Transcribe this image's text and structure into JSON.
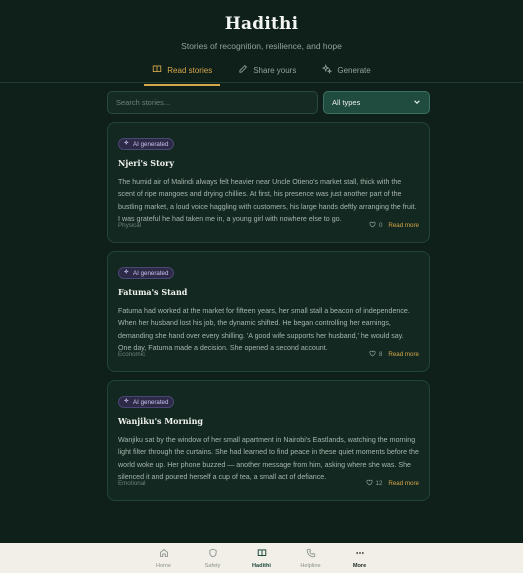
{
  "header": {
    "title": "Hadithi",
    "subtitle": "Stories of recognition, resilience, and hope"
  },
  "tabs": [
    {
      "label": "Read stories",
      "icon": "book-icon",
      "active": true
    },
    {
      "label": "Share yours",
      "icon": "pen-icon",
      "active": false
    },
    {
      "label": "Generate",
      "icon": "sparkle-icon",
      "active": false
    }
  ],
  "search": {
    "placeholder": "Search stories...",
    "value": ""
  },
  "filter": {
    "selected": "All types"
  },
  "stories": [
    {
      "badge": "AI generated",
      "title": "Njeri's Story",
      "excerpt": "The humid air of Malindi always felt heavier near Uncle Otieno's market stall, thick with the scent of ripe mangoes and drying chillies. At first, his presence was just another part of the bustling market, a loud voice haggling with customers, his large hands deftly arranging the fruit. I was grateful he had taken me in, a young girl with nowhere else to go.",
      "category": "Physical",
      "likes": "0",
      "read_more": "Read more"
    },
    {
      "badge": "AI generated",
      "title": "Fatuma's Stand",
      "excerpt": "Fatuma had worked at the market for fifteen years, her small stall a beacon of independence. When her husband lost his job, the dynamic shifted. He began controlling her earnings, demanding she hand over every shilling. 'A good wife supports her husband,' he would say. One day, Fatuma made a decision. She opened a second account.",
      "category": "Economic",
      "likes": "8",
      "read_more": "Read more"
    },
    {
      "badge": "AI generated",
      "title": "Wanjiku's Morning",
      "excerpt": "Wanjiku sat by the window of her small apartment in Nairobi's Eastlands, watching the morning light filter through the curtains. She had learned to find peace in these quiet moments before the world woke up. Her phone buzzed — another message from him, asking where she was. She silenced it and poured herself a cup of tea, a small act of defiance.",
      "category": "Emotional",
      "likes": "12",
      "read_more": "Read more"
    }
  ],
  "bottom_nav": [
    {
      "label": "Home",
      "icon": "home-icon",
      "active": false
    },
    {
      "label": "Safety",
      "icon": "shield-icon",
      "active": false
    },
    {
      "label": "Hadithi",
      "icon": "book-open-icon",
      "active": true
    },
    {
      "label": "Helpline",
      "icon": "phone-icon",
      "active": false
    },
    {
      "label": "More",
      "icon": "more-dots-icon",
      "active": false
    }
  ],
  "colors": {
    "background": "#0f201a",
    "accent": "#d6a64a",
    "card": "#132820",
    "badge": "#2d2a47",
    "nav_active": "#1f4c3f"
  }
}
